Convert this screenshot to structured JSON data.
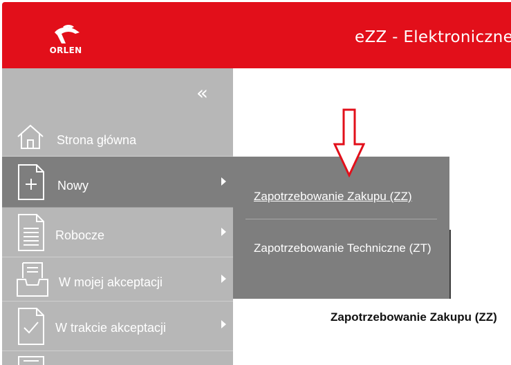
{
  "header": {
    "logo_text": "ORLEN",
    "title": "eZZ - Elektroniczne"
  },
  "sidebar": {
    "collapse_glyph": "«",
    "items": [
      {
        "label": "Strona główna",
        "icon": "home-icon",
        "has_submenu": false,
        "active": false
      },
      {
        "label": "Nowy",
        "icon": "new-document-icon",
        "has_submenu": true,
        "active": true
      },
      {
        "label": "Robocze",
        "icon": "document-lines-icon",
        "has_submenu": true,
        "active": false
      },
      {
        "label": "W mojej akceptacji",
        "icon": "inbox-tray-icon",
        "has_submenu": true,
        "active": false
      },
      {
        "label": "W trakcie akceptacji",
        "icon": "document-check-icon",
        "has_submenu": true,
        "active": false
      }
    ]
  },
  "submenu": {
    "items": [
      {
        "label": "Zapotrzebowanie Zakupu (ZZ)"
      },
      {
        "label": "Zapotrzebowanie Techniczne (ZT)"
      }
    ]
  },
  "main": {
    "heading": "Zapotrzebowanie Zakupu (ZZ)"
  },
  "colors": {
    "brand_red": "#e20f1a",
    "sidebar_bg": "#b7b7b7",
    "active_bg": "#7e7e7e",
    "annotation_arrow": "#e20f1a"
  }
}
